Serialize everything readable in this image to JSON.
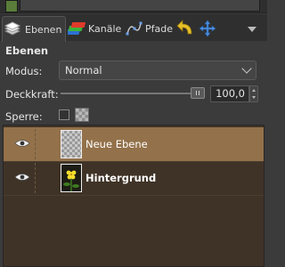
{
  "window": {
    "image_selector": ""
  },
  "tabs": [
    {
      "label": "Ebenen",
      "icon": "layers-icon",
      "active": true
    },
    {
      "label": "Kanäle",
      "icon": "channels-icon",
      "active": false
    },
    {
      "label": "Pfade",
      "icon": "paths-icon",
      "active": false
    },
    {
      "label": "",
      "icon": "undo-history-icon",
      "active": false
    },
    {
      "label": "",
      "icon": "navigation-icon",
      "active": false
    }
  ],
  "panel": {
    "title": "Ebenen",
    "mode_label": "Modus:",
    "mode_value": "Normal",
    "opacity_label": "Deckkraft:",
    "opacity_value": "100,0",
    "opacity_fraction": 1.0,
    "lock_label": "Sperre:"
  },
  "layers": [
    {
      "name": "Neue Ebene",
      "visible": true,
      "selected": true,
      "thumbnail": "transparent"
    },
    {
      "name": "Hintergrund",
      "visible": true,
      "selected": false,
      "thumbnail": "flower-photo"
    }
  ],
  "colors": {
    "background": "#3b3b3b",
    "selection": "#93714a",
    "layer_list_bg": "#3f3327"
  }
}
